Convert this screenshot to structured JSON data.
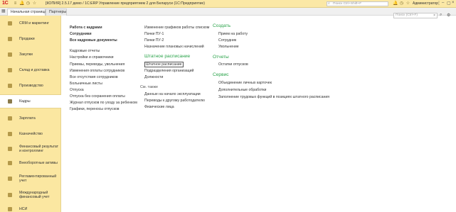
{
  "titlebar": {
    "logo": "1С",
    "title": "[КОПИЯ] 2.5.17 демо / 1С:ERP Управление предприятием 2 для Беларуси  (1С:Предприятие)",
    "search_placeholder": "Поиск Ctrl+Shift+F",
    "user": "Администратор"
  },
  "tabs": [
    {
      "label": "Начальная страница"
    },
    {
      "label": "Партнеры"
    }
  ],
  "sidebar": {
    "items": [
      {
        "label": "CRM и маркетинг"
      },
      {
        "label": "Продажи"
      },
      {
        "label": "Закупки"
      },
      {
        "label": "Склад и доставка"
      },
      {
        "label": "Производство"
      },
      {
        "label": "Кадры"
      },
      {
        "label": "Зарплата"
      },
      {
        "label": "Казначейство"
      },
      {
        "label": "Финансовый результат и контроллинг"
      },
      {
        "label": "Внеоборотные активы"
      },
      {
        "label": "Регламентированный учет"
      },
      {
        "label": "Международный финансовый учет"
      },
      {
        "label": "НСИ"
      }
    ]
  },
  "content": {
    "search_placeholder": "Поиск (Ctrl+F)",
    "col1": {
      "bold_links": [
        "Работа с кадрами",
        "Сотрудники",
        "Все кадровые документы"
      ],
      "links": [
        "Кадровые отчеты",
        "Настройки и справочники",
        "Приемы, переводы, увольнения",
        "Изменения оплаты сотрудников",
        "Все отсутствия сотрудников",
        "Больничные листы",
        "Отпуска",
        "Отпуска без сохранения оплаты",
        "Журнал отпусков по уходу за ребенком",
        "Графики, переносы отпусков"
      ]
    },
    "col2": {
      "links_top": [
        "Изменение графиков работы списком",
        "Пачки ПУ-1",
        "Пачки ПУ-2",
        "Назначение плановых начислений"
      ],
      "section1_title": "Штатное расписание",
      "section1_links": [
        "Штатное расписание",
        "Подразделения организаций",
        "Должности"
      ],
      "section2_title": "См. также",
      "section2_links": [
        "Данные на начало эксплуатации",
        "Переводы к другому работодателю",
        "Физические лица"
      ]
    },
    "col3": {
      "create_title": "Создать",
      "create_links": [
        "Прием на работу",
        "Сотрудник",
        "Увольнение"
      ],
      "reports_title": "Отчеты",
      "reports_links": [
        "Остатки отпусков"
      ],
      "service_title": "Сервис",
      "service_links": [
        "Объединение личных карточек",
        "Дополнительные обработки",
        "Заполнение трудовых функций в позициях штатного расписания"
      ]
    }
  }
}
